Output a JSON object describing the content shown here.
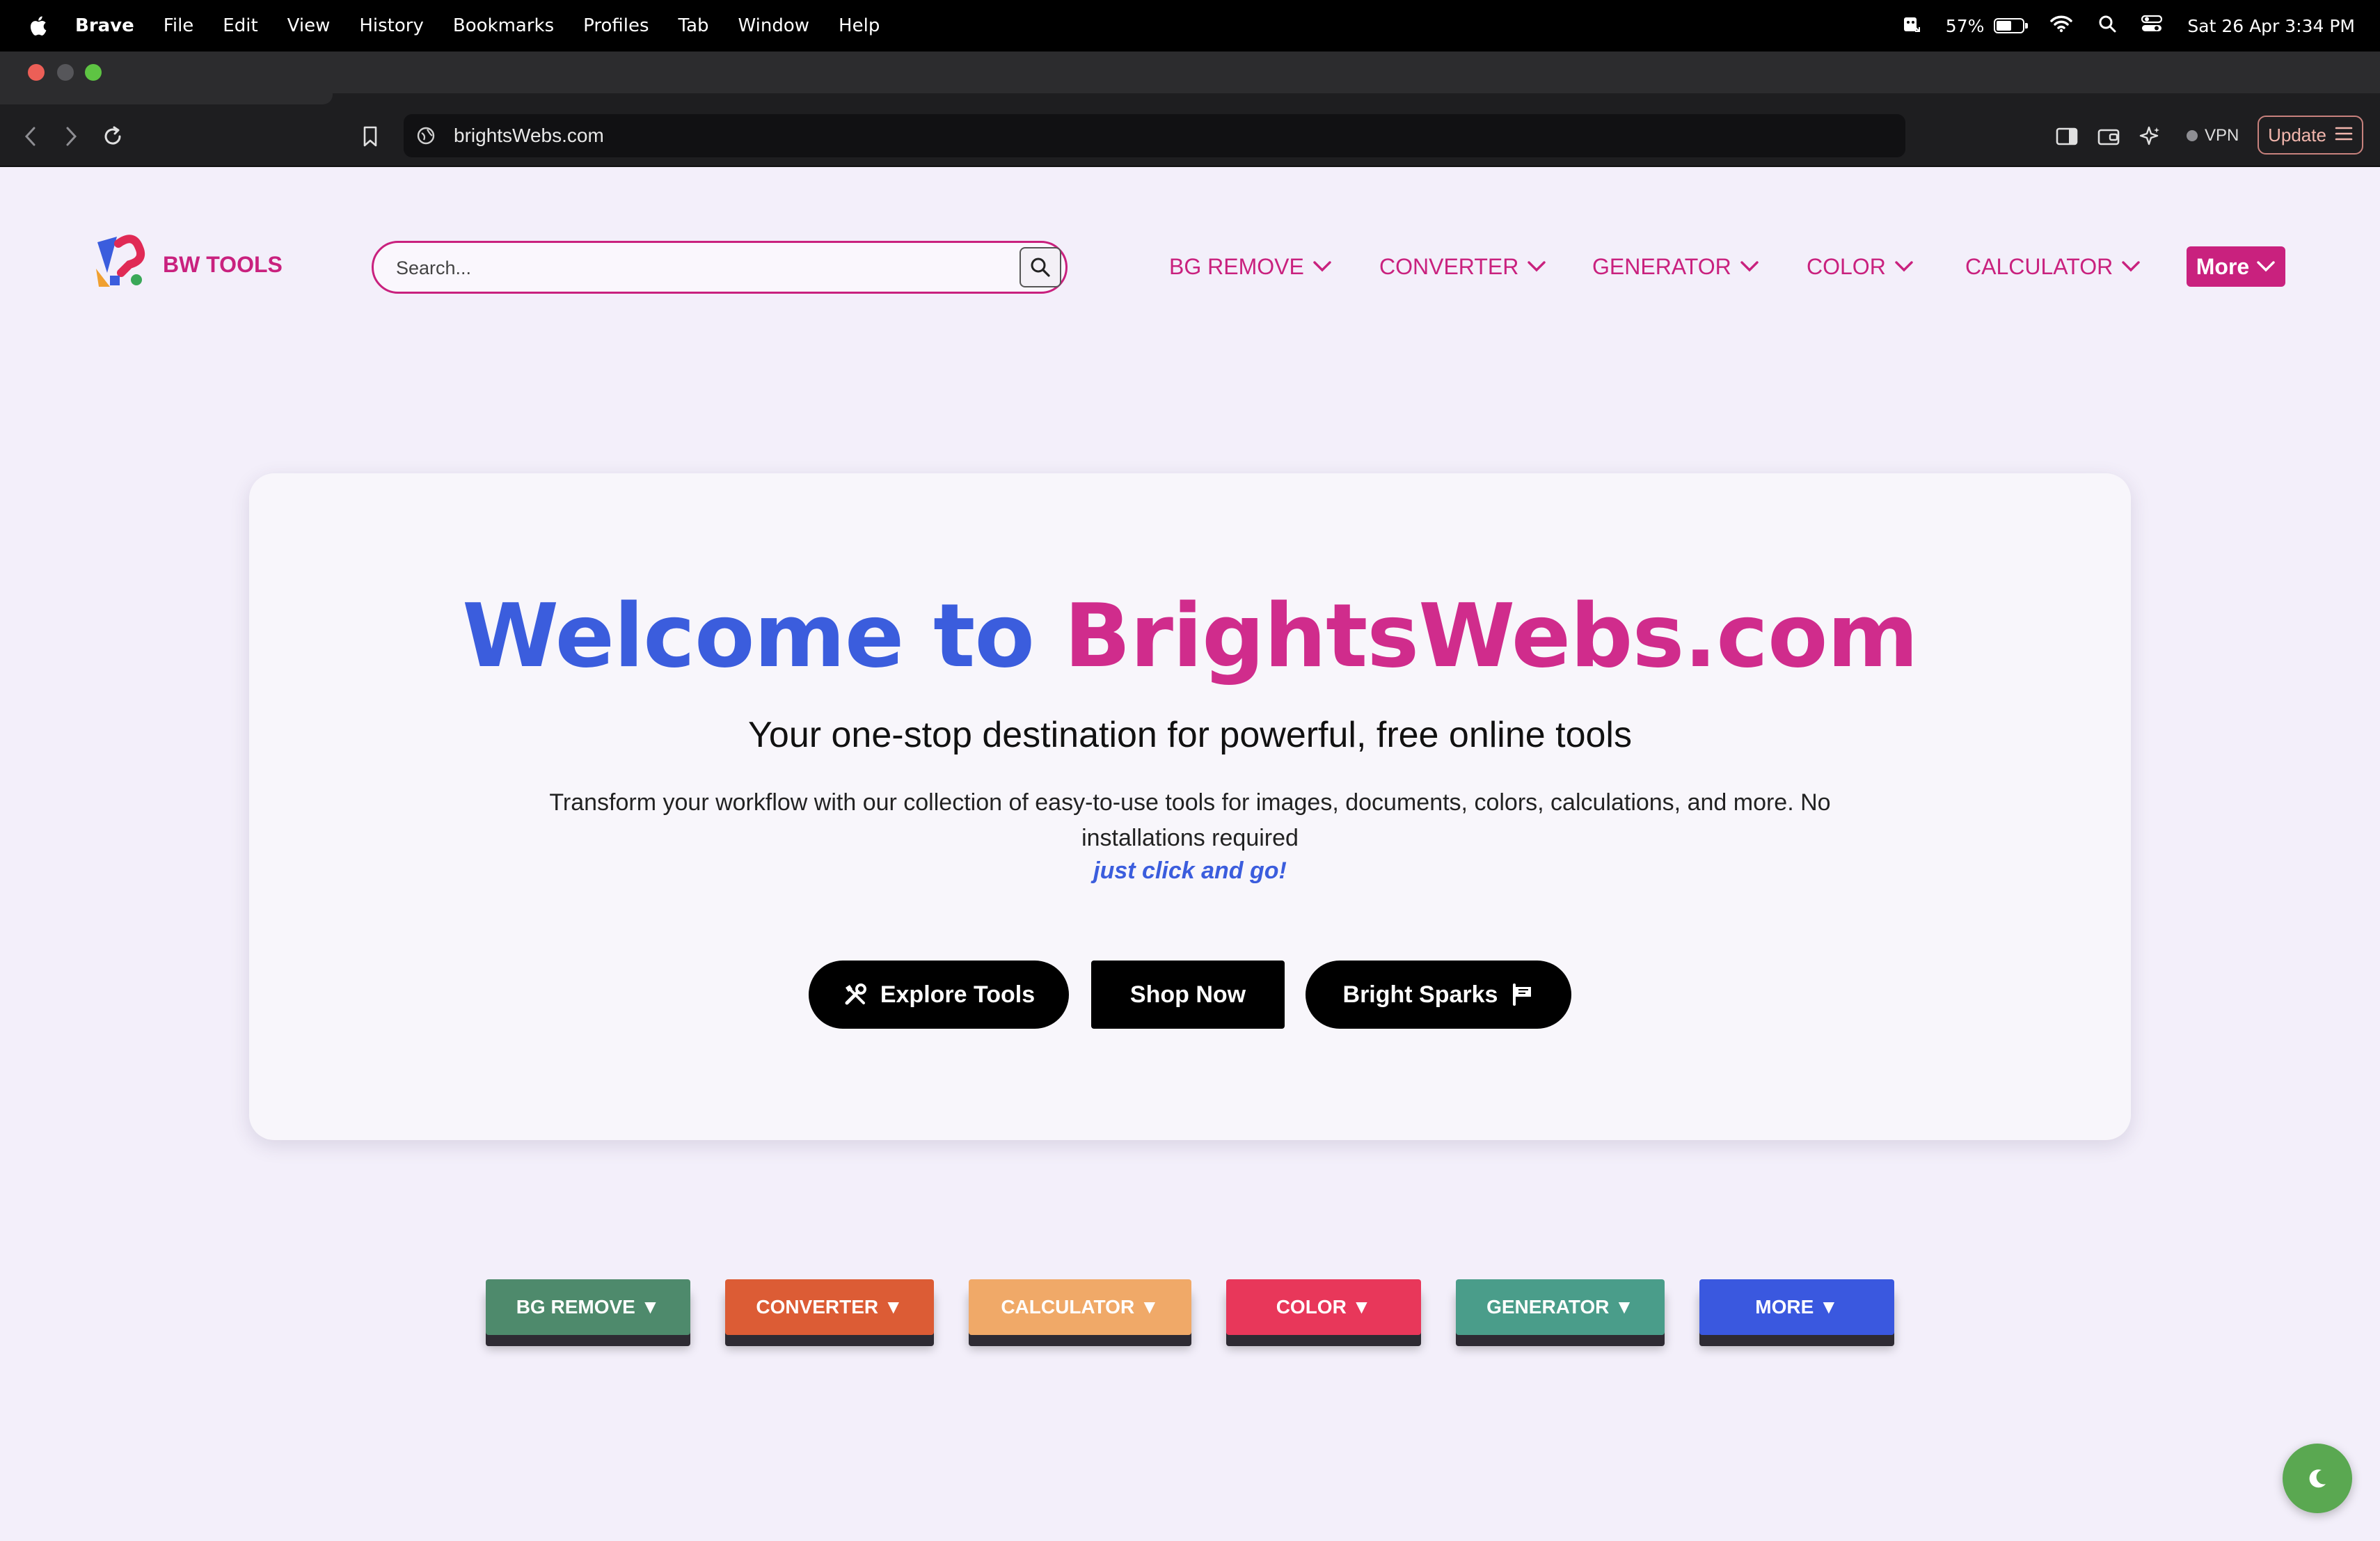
{
  "menubar": {
    "app_name": "Brave",
    "items": [
      "File",
      "Edit",
      "View",
      "History",
      "Bookmarks",
      "Profiles",
      "Tab",
      "Window",
      "Help"
    ],
    "battery_percent": "57%",
    "battery_level": 0.57,
    "datetime": "Sat 26 Apr  3:34 PM"
  },
  "browser": {
    "url": "brightsWebs.com",
    "vpn_label": "VPN",
    "update_label": "Update"
  },
  "header": {
    "brand": "BW TOOLS",
    "search_placeholder": "Search...",
    "nav": [
      {
        "label": "BG REMOVE"
      },
      {
        "label": "CONVERTER"
      },
      {
        "label": "GENERATOR"
      },
      {
        "label": "COLOR"
      },
      {
        "label": "CALCULATOR"
      }
    ],
    "more_label": "More"
  },
  "hero": {
    "title_part1": "Welcome to",
    "title_part2": "BrightsWebs.com",
    "subtitle": "Your one-stop destination for powerful, free online tools",
    "description": "Transform your workflow with our collection of easy-to-use tools for images, documents, colors, calculations, and more. No installations required",
    "emphasis": "just click and go!",
    "buttons": {
      "explore": "Explore Tools",
      "shop": "Shop Now",
      "sparks": "Bright Sparks"
    }
  },
  "categories": [
    {
      "label": "BG REMOVE ▼",
      "color": "#4e8a6c"
    },
    {
      "label": "CONVERTER ▼",
      "color": "#dc5c35"
    },
    {
      "label": "CALCULATOR ▼",
      "color": "#f0a968"
    },
    {
      "label": "COLOR ▼",
      "color": "#e8375a"
    },
    {
      "label": "GENERATOR ▼",
      "color": "#4a9d8a"
    },
    {
      "label": "MORE ▼",
      "color": "#3a58df"
    }
  ],
  "colors": {
    "brand_pink": "#c9217e",
    "accent_blue": "#3b5ddd",
    "theme_toggle": "#5aa851"
  }
}
